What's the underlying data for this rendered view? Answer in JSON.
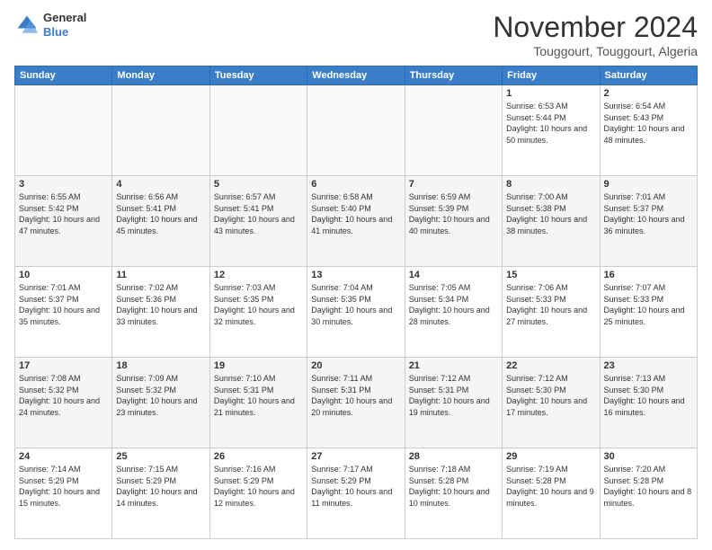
{
  "header": {
    "logo_line1": "General",
    "logo_line2": "Blue",
    "month": "November 2024",
    "location": "Touggourt, Touggourt, Algeria"
  },
  "weekdays": [
    "Sunday",
    "Monday",
    "Tuesday",
    "Wednesday",
    "Thursday",
    "Friday",
    "Saturday"
  ],
  "weeks": [
    [
      {
        "day": "",
        "info": ""
      },
      {
        "day": "",
        "info": ""
      },
      {
        "day": "",
        "info": ""
      },
      {
        "day": "",
        "info": ""
      },
      {
        "day": "",
        "info": ""
      },
      {
        "day": "1",
        "info": "Sunrise: 6:53 AM\nSunset: 5:44 PM\nDaylight: 10 hours\nand 50 minutes."
      },
      {
        "day": "2",
        "info": "Sunrise: 6:54 AM\nSunset: 5:43 PM\nDaylight: 10 hours\nand 48 minutes."
      }
    ],
    [
      {
        "day": "3",
        "info": "Sunrise: 6:55 AM\nSunset: 5:42 PM\nDaylight: 10 hours\nand 47 minutes."
      },
      {
        "day": "4",
        "info": "Sunrise: 6:56 AM\nSunset: 5:41 PM\nDaylight: 10 hours\nand 45 minutes."
      },
      {
        "day": "5",
        "info": "Sunrise: 6:57 AM\nSunset: 5:41 PM\nDaylight: 10 hours\nand 43 minutes."
      },
      {
        "day": "6",
        "info": "Sunrise: 6:58 AM\nSunset: 5:40 PM\nDaylight: 10 hours\nand 41 minutes."
      },
      {
        "day": "7",
        "info": "Sunrise: 6:59 AM\nSunset: 5:39 PM\nDaylight: 10 hours\nand 40 minutes."
      },
      {
        "day": "8",
        "info": "Sunrise: 7:00 AM\nSunset: 5:38 PM\nDaylight: 10 hours\nand 38 minutes."
      },
      {
        "day": "9",
        "info": "Sunrise: 7:01 AM\nSunset: 5:37 PM\nDaylight: 10 hours\nand 36 minutes."
      }
    ],
    [
      {
        "day": "10",
        "info": "Sunrise: 7:01 AM\nSunset: 5:37 PM\nDaylight: 10 hours\nand 35 minutes."
      },
      {
        "day": "11",
        "info": "Sunrise: 7:02 AM\nSunset: 5:36 PM\nDaylight: 10 hours\nand 33 minutes."
      },
      {
        "day": "12",
        "info": "Sunrise: 7:03 AM\nSunset: 5:35 PM\nDaylight: 10 hours\nand 32 minutes."
      },
      {
        "day": "13",
        "info": "Sunrise: 7:04 AM\nSunset: 5:35 PM\nDaylight: 10 hours\nand 30 minutes."
      },
      {
        "day": "14",
        "info": "Sunrise: 7:05 AM\nSunset: 5:34 PM\nDaylight: 10 hours\nand 28 minutes."
      },
      {
        "day": "15",
        "info": "Sunrise: 7:06 AM\nSunset: 5:33 PM\nDaylight: 10 hours\nand 27 minutes."
      },
      {
        "day": "16",
        "info": "Sunrise: 7:07 AM\nSunset: 5:33 PM\nDaylight: 10 hours\nand 25 minutes."
      }
    ],
    [
      {
        "day": "17",
        "info": "Sunrise: 7:08 AM\nSunset: 5:32 PM\nDaylight: 10 hours\nand 24 minutes."
      },
      {
        "day": "18",
        "info": "Sunrise: 7:09 AM\nSunset: 5:32 PM\nDaylight: 10 hours\nand 23 minutes."
      },
      {
        "day": "19",
        "info": "Sunrise: 7:10 AM\nSunset: 5:31 PM\nDaylight: 10 hours\nand 21 minutes."
      },
      {
        "day": "20",
        "info": "Sunrise: 7:11 AM\nSunset: 5:31 PM\nDaylight: 10 hours\nand 20 minutes."
      },
      {
        "day": "21",
        "info": "Sunrise: 7:12 AM\nSunset: 5:31 PM\nDaylight: 10 hours\nand 19 minutes."
      },
      {
        "day": "22",
        "info": "Sunrise: 7:12 AM\nSunset: 5:30 PM\nDaylight: 10 hours\nand 17 minutes."
      },
      {
        "day": "23",
        "info": "Sunrise: 7:13 AM\nSunset: 5:30 PM\nDaylight: 10 hours\nand 16 minutes."
      }
    ],
    [
      {
        "day": "24",
        "info": "Sunrise: 7:14 AM\nSunset: 5:29 PM\nDaylight: 10 hours\nand 15 minutes."
      },
      {
        "day": "25",
        "info": "Sunrise: 7:15 AM\nSunset: 5:29 PM\nDaylight: 10 hours\nand 14 minutes."
      },
      {
        "day": "26",
        "info": "Sunrise: 7:16 AM\nSunset: 5:29 PM\nDaylight: 10 hours\nand 12 minutes."
      },
      {
        "day": "27",
        "info": "Sunrise: 7:17 AM\nSunset: 5:29 PM\nDaylight: 10 hours\nand 11 minutes."
      },
      {
        "day": "28",
        "info": "Sunrise: 7:18 AM\nSunset: 5:28 PM\nDaylight: 10 hours\nand 10 minutes."
      },
      {
        "day": "29",
        "info": "Sunrise: 7:19 AM\nSunset: 5:28 PM\nDaylight: 10 hours\nand 9 minutes."
      },
      {
        "day": "30",
        "info": "Sunrise: 7:20 AM\nSunset: 5:28 PM\nDaylight: 10 hours\nand 8 minutes."
      }
    ]
  ]
}
